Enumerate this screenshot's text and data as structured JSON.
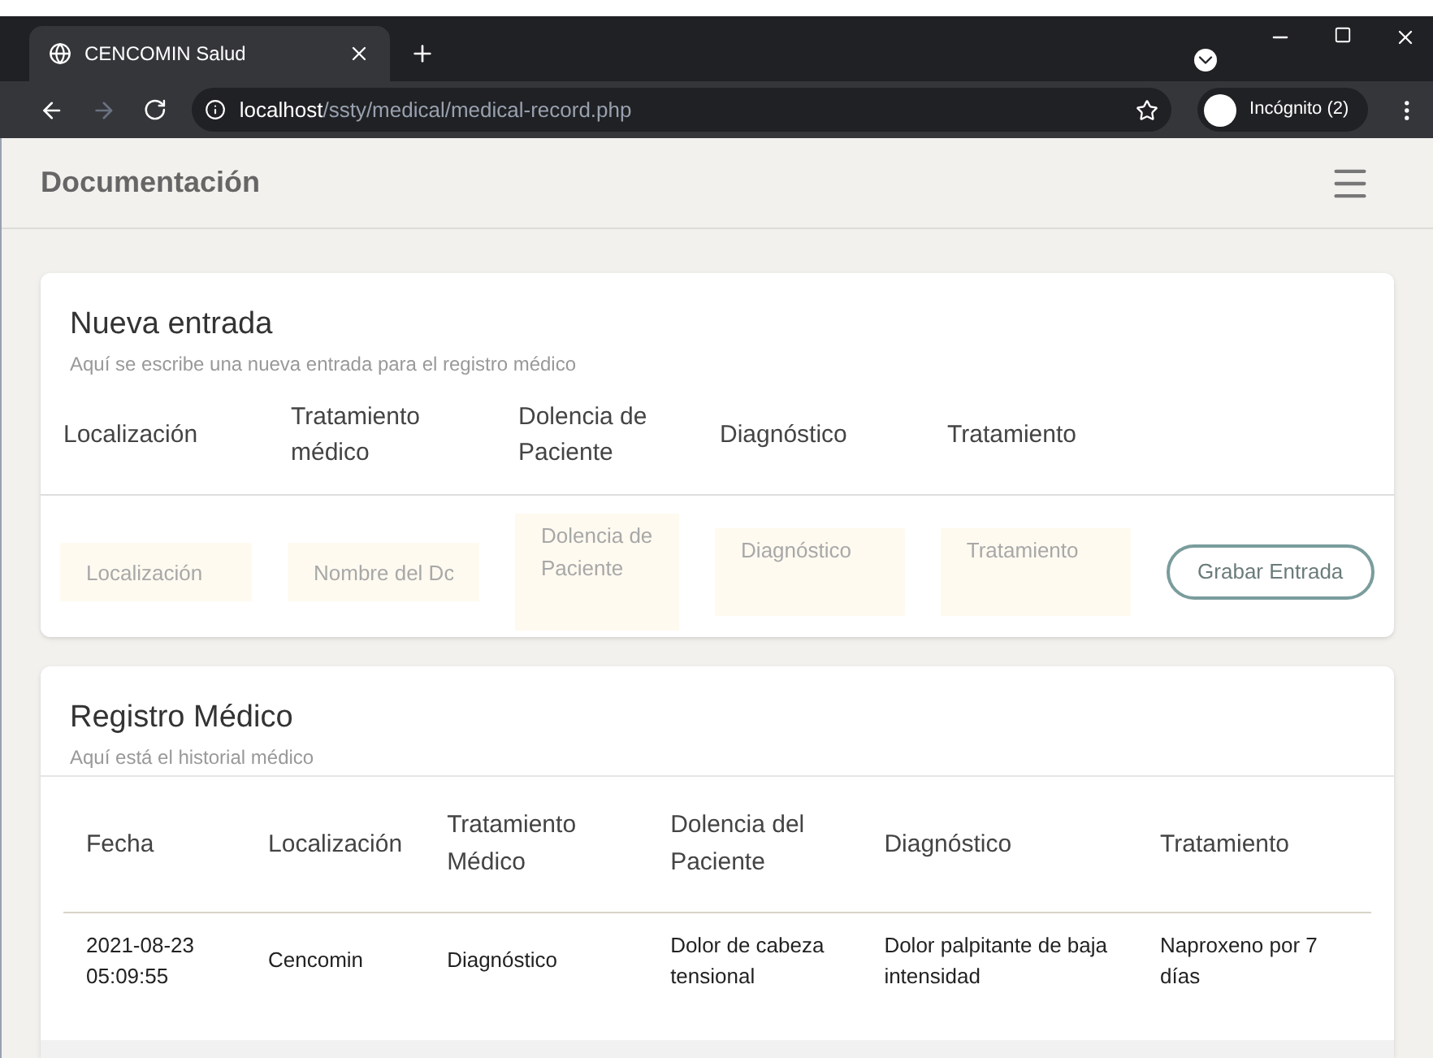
{
  "browser": {
    "tab_title": "CENCOMIN Salud",
    "url_host": "localhost",
    "url_path": "/ssty/medical/medical-record.php",
    "profile": "Incógnito (2)"
  },
  "header": {
    "title": "Documentación"
  },
  "new_entry": {
    "title": "Nueva entrada",
    "subtitle": "Aquí se escribe una nueva entrada para el registro médico",
    "columns": [
      "Localización",
      "Tratamiento médico",
      "Dolencia de Paciente",
      "Diagnóstico",
      "Tratamiento"
    ],
    "fields": [
      {
        "placeholder": "Localización",
        "kind": "input"
      },
      {
        "placeholder": "Nombre del Dc",
        "kind": "input"
      },
      {
        "placeholder": "Dolencia de Paciente",
        "kind": "textarea"
      },
      {
        "placeholder": "Diagnóstico",
        "kind": "textarea"
      },
      {
        "placeholder": "Tratamiento",
        "kind": "textarea"
      }
    ],
    "button": "Grabar Entrada"
  },
  "record": {
    "title": "Registro Médico",
    "subtitle": "Aquí está el historial médico",
    "columns": [
      "Fecha",
      "Localización",
      "Tratamiento Médico",
      "Dolencia del Paciente",
      "Diagnóstico",
      "Tratamiento"
    ],
    "rows": [
      [
        "2021-08-23 05:09:55",
        "Cencomin",
        "Diagnóstico",
        "Dolor de cabeza tensional",
        "Dolor palpitante de baja intensidad",
        "Naproxeno por 7 días"
      ]
    ]
  }
}
